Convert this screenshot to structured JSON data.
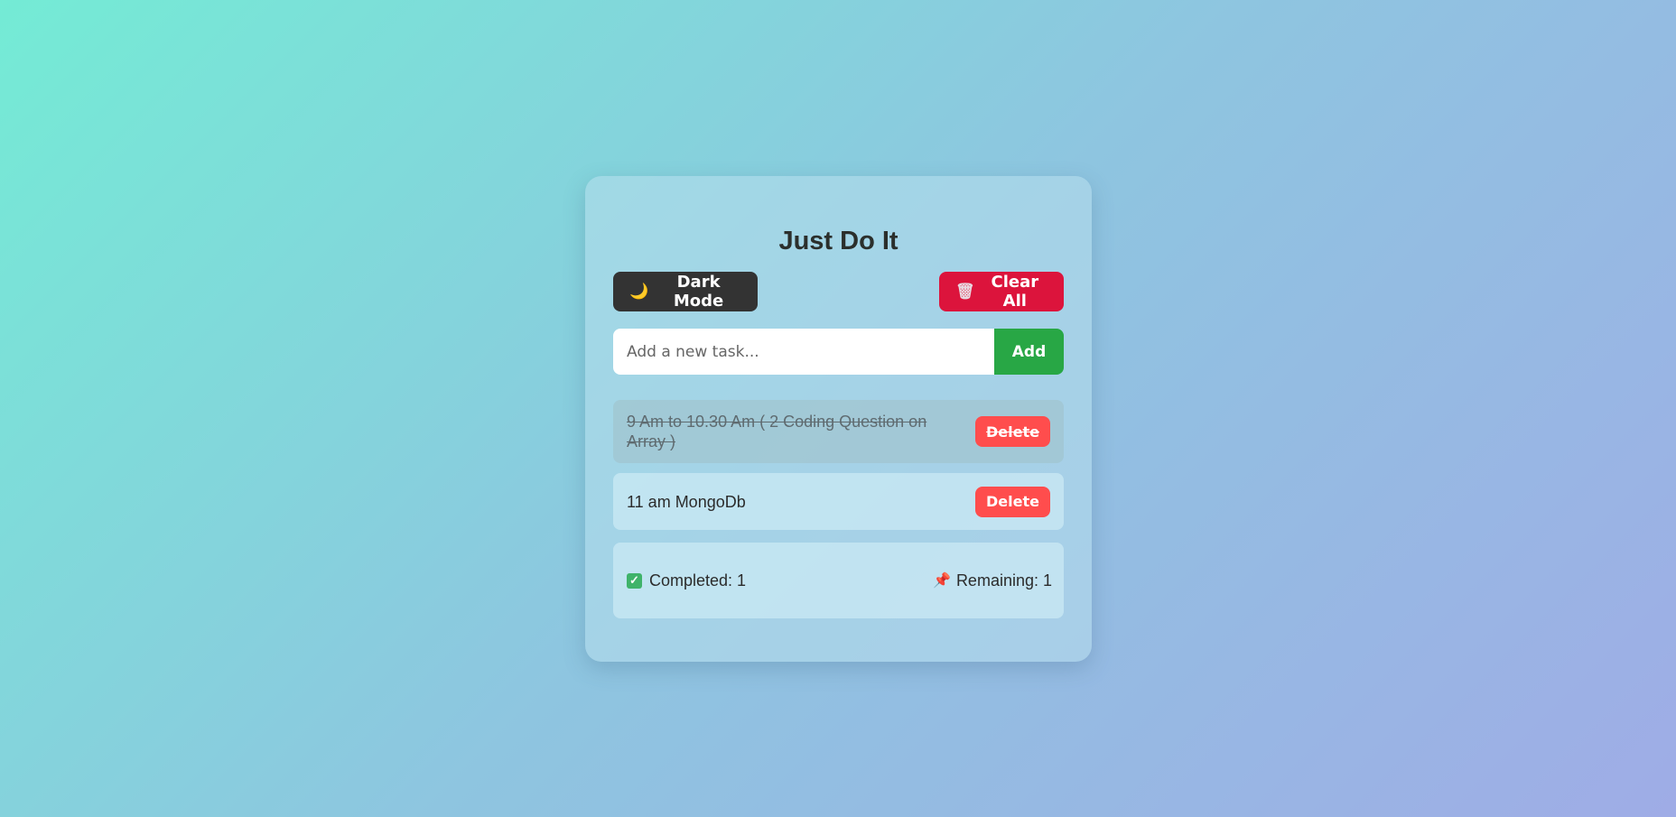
{
  "app": {
    "title": "Just Do It"
  },
  "toolbar": {
    "dark_mode_icon": "moon-icon",
    "dark_mode_glyph": "🌙",
    "dark_mode_label": "Dark Mode",
    "clear_all_icon": "trash-icon",
    "clear_all_glyph": "🗑",
    "clear_all_label": "Clear All"
  },
  "new_task": {
    "placeholder": "Add a new task...",
    "value": "",
    "add_label": "Add"
  },
  "tasks": [
    {
      "text": "9 Am to 10.30 Am ( 2 Coding Question on Array )",
      "completed": true,
      "delete_label": "Delete"
    },
    {
      "text": "11 am MongoDb",
      "completed": false,
      "delete_label": "Delete"
    }
  ],
  "stats": {
    "completed_label": "Completed: 1",
    "remaining_label": "Remaining: 1",
    "completed_icon": "check-icon",
    "remaining_icon": "pin-icon",
    "completed_glyph": "✓",
    "remaining_glyph": "📌"
  },
  "colors": {
    "add_button": "#28a745",
    "clear_button": "#dc143c",
    "delete_button": "#ff4d4d",
    "dark_button": "#333333"
  }
}
